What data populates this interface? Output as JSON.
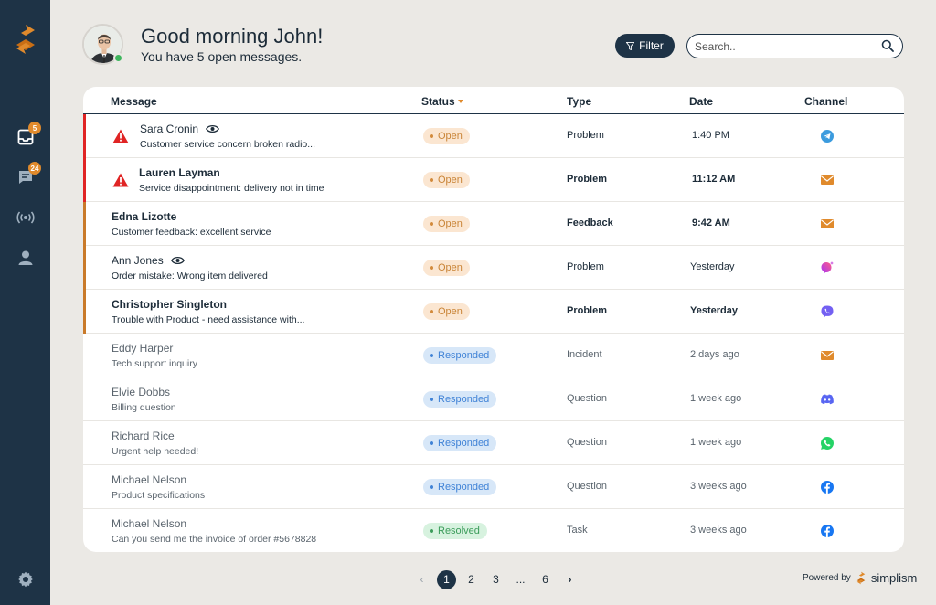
{
  "sidebar": {
    "nav": [
      {
        "icon": "inbox-icon",
        "badge": "5"
      },
      {
        "icon": "chat-icon",
        "badge": "24"
      },
      {
        "icon": "broadcast-icon",
        "badge": ""
      },
      {
        "icon": "user-icon",
        "badge": ""
      }
    ],
    "settings_icon": "gear-icon"
  },
  "header": {
    "greeting": "Good morning John!",
    "subtitle": "You have 5 open messages.",
    "filter_label": "Filter",
    "search_placeholder": "Search.."
  },
  "table": {
    "columns": {
      "message": "Message",
      "status": "Status",
      "type": "Type",
      "date": "Date",
      "channel": "Channel"
    },
    "rows": [
      {
        "name": "Sara Cronin",
        "preview": "Customer service concern broken radio...",
        "status": "Open",
        "type": "Problem",
        "date": "1:40 PM",
        "channel": "telegram-icon",
        "urgent": true,
        "seen": true
      },
      {
        "name": "Lauren Layman",
        "preview": "Service disappointment: delivery not in time",
        "status": "Open",
        "type": "Problem",
        "date": "11:12 AM",
        "channel": "email-icon",
        "urgent": true,
        "seen": false
      },
      {
        "name": "Edna Lizotte",
        "preview": "Customer feedback: excellent service",
        "status": "Open",
        "type": "Feedback",
        "date": "9:42 AM",
        "channel": "email-icon",
        "urgent": false,
        "seen": false
      },
      {
        "name": "Ann Jones",
        "preview": "Order mistake: Wrong item delivered",
        "status": "Open",
        "type": "Problem",
        "date": "Yesterday",
        "channel": "messenger-icon",
        "urgent": false,
        "seen": true
      },
      {
        "name": "Christopher Singleton",
        "preview": "Trouble with Product - need assistance with...",
        "status": "Open",
        "type": "Problem",
        "date": "Yesterday",
        "channel": "viber-icon",
        "urgent": false,
        "seen": false
      },
      {
        "name": "Eddy Harper",
        "preview": "Tech support inquiry",
        "status": "Responded",
        "type": "Incident",
        "date": "2 days ago",
        "channel": "email-icon"
      },
      {
        "name": "Elvie Dobbs",
        "preview": "Billing question",
        "status": "Responded",
        "type": "Question",
        "date": "1 week ago",
        "channel": "discord-icon"
      },
      {
        "name": "Richard Rice",
        "preview": "Urgent help needed!",
        "status": "Responded",
        "type": "Question",
        "date": "1 week ago",
        "channel": "whatsapp-icon"
      },
      {
        "name": "Michael Nelson",
        "preview": "Product specifications",
        "status": "Responded",
        "type": "Question",
        "date": "3 weeks ago",
        "channel": "facebook-icon"
      },
      {
        "name": "Michael Nelson",
        "preview": "Can you send me the invoice of order #5678828",
        "status": "Resolved",
        "type": "Task",
        "date": "3 weeks ago",
        "channel": "facebook-icon"
      }
    ]
  },
  "pagination": {
    "prev": "‹",
    "pages": [
      "1",
      "2",
      "3",
      "...",
      "6"
    ],
    "next": "›",
    "current": "1"
  },
  "footer": {
    "powered_by": "Powered by",
    "brand": "simplism"
  },
  "colors": {
    "accent": "#e08a2c",
    "navy": "#1e3346",
    "urgent": "#e02424",
    "open_bar": "#c97a2a"
  }
}
